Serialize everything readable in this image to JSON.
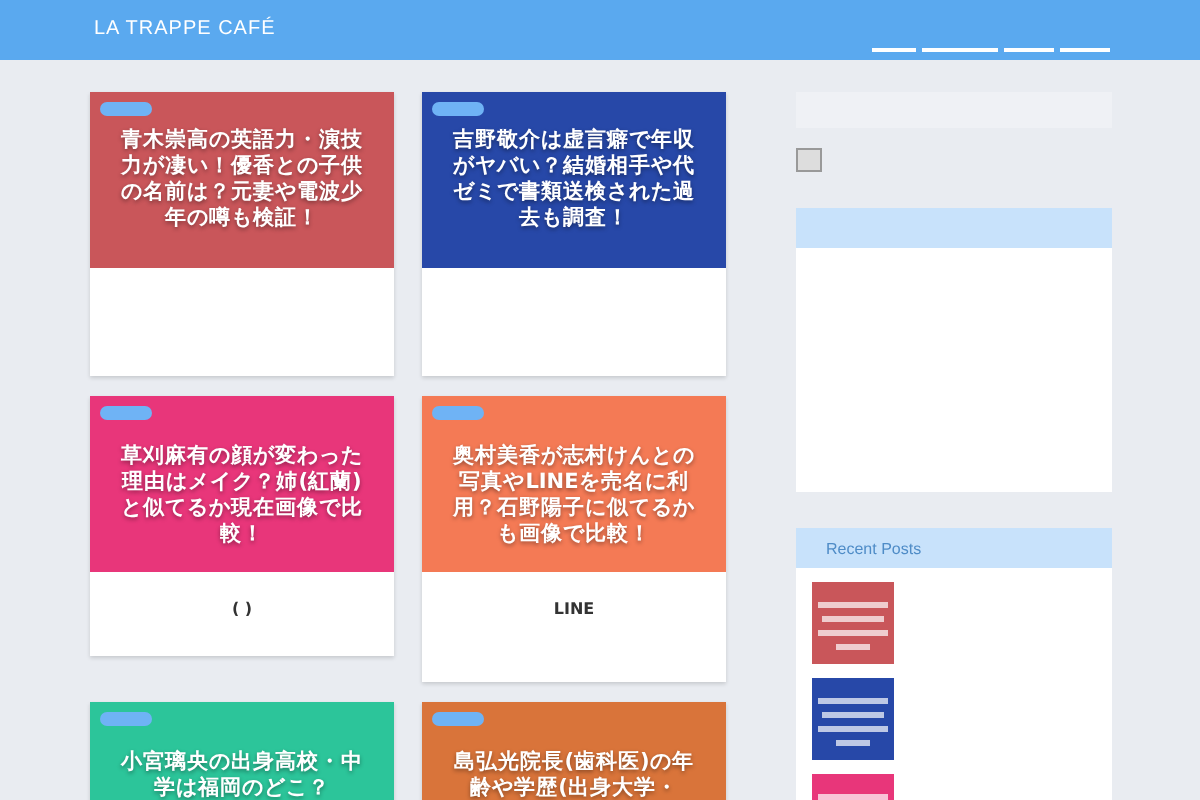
{
  "header": {
    "site_title": "LA TRAPPE CAFÉ"
  },
  "posts": [
    {
      "thumbnail_text": "青木崇高の英語力・演技力が凄い！優香との子供の名前は？元妻や電波少年の噂も検証！",
      "color": "#c9565a"
    },
    {
      "thumbnail_text": "吉野敬介は虚言癖で年収がヤバい？結婚相手や代ゼミで書類送検された過去も調査！",
      "color": "#2748a8"
    },
    {
      "thumbnail_text": "草刈麻有の顔が変わった理由はメイク？姉(紅蘭)と似てるか現在画像で比較！",
      "color": "#e8367a",
      "excerpt": "(  )"
    },
    {
      "thumbnail_text": "奥村美香が志村けんとの写真やLINEを売名に利用？石野陽子に似てるかも画像で比較！",
      "color": "#f47a55",
      "excerpt": "LINE"
    },
    {
      "thumbnail_text": "小宮璃央の出身高校・中学は福岡のどこ？",
      "color": "#2cc59a"
    },
    {
      "thumbnail_text": "島弘光院長(歯科医)の年齢や学歴(出身大学・",
      "color": "#d9743a"
    }
  ],
  "sidebar": {
    "recent_posts": {
      "title": "Recent Posts",
      "thumbnails": [
        {
          "color": "#c9565a"
        },
        {
          "color": "#2748a8"
        },
        {
          "color": "#e8367a"
        }
      ]
    }
  }
}
